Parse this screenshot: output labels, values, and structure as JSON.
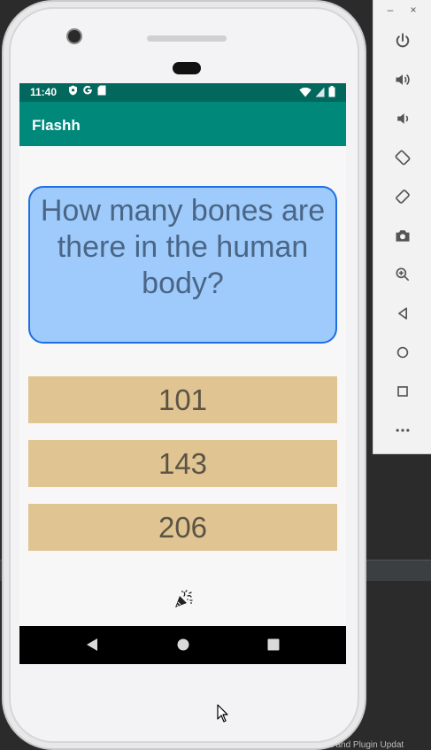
{
  "app": {
    "title": "Flashh"
  },
  "status_bar": {
    "time": "11:40",
    "left_icons": [
      "shield-icon",
      "google-icon",
      "sd-card-icon"
    ],
    "right_icons": [
      "wifi-icon",
      "signal-icon",
      "battery-icon"
    ]
  },
  "question": {
    "text": "How many bones are there in the human body?"
  },
  "answers": [
    {
      "label": "101"
    },
    {
      "label": "143"
    },
    {
      "label": "206"
    }
  ],
  "toggle": {
    "icon": "party-popper-icon"
  },
  "emulator_toolbar": {
    "window_buttons": [
      "–",
      "×"
    ],
    "tools": [
      "power-icon",
      "volume-up-icon",
      "volume-down-icon",
      "rotate-left-icon",
      "rotate-right-icon",
      "camera-icon",
      "zoom-icon",
      "back-icon",
      "home-icon",
      "overview-icon",
      "more-icon"
    ]
  },
  "ide": {
    "status_text": "IDE and Plugin Updat"
  },
  "colors": {
    "status_bar": "#02675d",
    "app_bar": "#00897b",
    "question_bg": "#9ecbfb",
    "question_border": "#1e6fe0",
    "answer_bg": "#e0c491"
  }
}
